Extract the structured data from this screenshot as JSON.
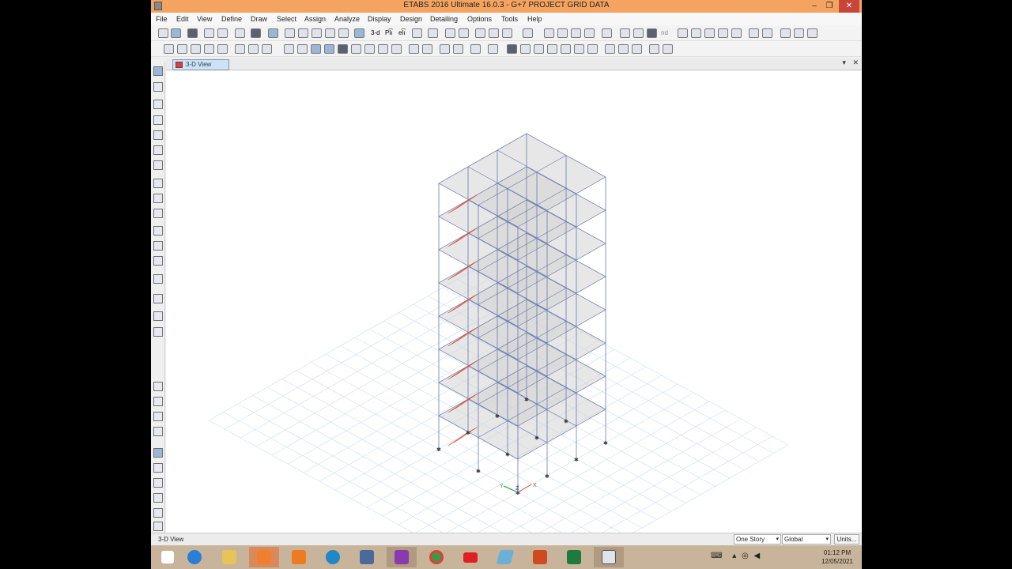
{
  "window": {
    "title": "ETABS 2016 Ultimate 16.0.3 - G+7 PROJECT GRID DATA",
    "minimize": "–",
    "maximize": "❐",
    "close": "✕"
  },
  "menu": [
    "File",
    "Edit",
    "View",
    "Define",
    "Draw",
    "Select",
    "Assign",
    "Analyze",
    "Display",
    "Design",
    "Detailing",
    "Options",
    "Tools",
    "Help"
  ],
  "toolbar": {
    "view_3d_label": "3-d",
    "plan_label": "Pl͡ı",
    "elev_label": "el͡ı",
    "nd_label": "nd"
  },
  "tab": {
    "label": "3-D View",
    "dropdown": "▾",
    "close": "✕"
  },
  "status": {
    "view_name": "3-D View",
    "story_select": "One Story",
    "coord_select": "Global",
    "units_label": "Units..."
  },
  "axis": {
    "x": "X",
    "y": "Y",
    "z": "Z"
  },
  "taskbar": {
    "time": "01:12 PM",
    "date": "12/05/2021",
    "apps": [
      "start",
      "internet-explorer",
      "file-explorer",
      "ppt-orange",
      "camera-app",
      "edge",
      "network-drive",
      "pdf-app",
      "chrome",
      "youtube",
      "notes-app",
      "powerpoint",
      "excel",
      "etabs"
    ]
  },
  "colors": {
    "titlebar": "#f4a460",
    "stair": "#f05a45",
    "frame": "#6a7ab0",
    "slab": "#d4d4d4",
    "grid": "#cfe2f2"
  }
}
